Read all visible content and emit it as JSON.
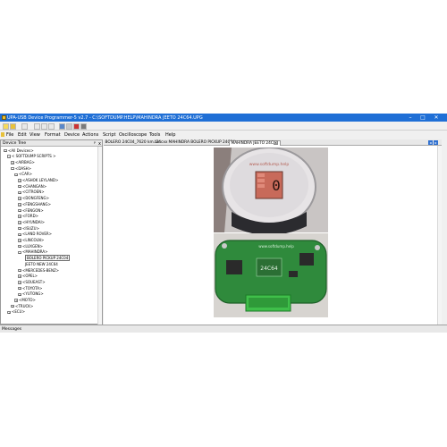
{
  "window": {
    "title": "UPA-USB Device Programmer-5 v2.7 - C:\\SOFTDUMP.HELP\\MAHINDRA JEETO 24C64.UPG",
    "minimize": "–",
    "maximize": "□",
    "close": "✕"
  },
  "menu": {
    "items": [
      "File",
      "Edit",
      "View",
      "Format",
      "Device",
      "Actions",
      "Script",
      "Oscilloscope",
      "Tools",
      "Help"
    ]
  },
  "device_tree": {
    "title": "Device Tree",
    "pin": "ᵖ",
    "close": "x",
    "rows": [
      {
        "label": "<All Devices>",
        "exp": "−"
      },
      {
        "label": "< SOFTDUMP SCRIPTS >",
        "exp": "−"
      },
      {
        "label": "<AIRBAG>",
        "exp": "+"
      },
      {
        "label": "<DASH>",
        "exp": "−"
      },
      {
        "label": "<CAR>",
        "exp": "−"
      },
      {
        "label": "<ASHOK LEYLAND>",
        "exp": "+"
      },
      {
        "label": "<CHANGAN>",
        "exp": "+"
      },
      {
        "label": "<CITROEN>",
        "exp": "+"
      },
      {
        "label": "<DONGFENG>",
        "exp": "+"
      },
      {
        "label": "<FENGSHANG>",
        "exp": "+"
      },
      {
        "label": "<FENGON>",
        "exp": "+"
      },
      {
        "label": "<FORD>",
        "exp": "+"
      },
      {
        "label": "<HYUNDAI>",
        "exp": "+"
      },
      {
        "label": "<ISUZU>",
        "exp": "+"
      },
      {
        "label": "<LAND ROVER>",
        "exp": "+"
      },
      {
        "label": "<LINCOLN>",
        "exp": "+"
      },
      {
        "label": "<LUXGEN>",
        "exp": "+"
      },
      {
        "label": "<MAHINDRA>",
        "exp": "−"
      },
      {
        "label": "BOLERO PICKUP 24C04",
        "exp": ""
      },
      {
        "label": "JEETO NEW 24C64",
        "exp": ""
      },
      {
        "label": "<MERCEDES-BENZ>",
        "exp": "+"
      },
      {
        "label": "<OPEL>",
        "exp": "+"
      },
      {
        "label": "<SOUEAST>",
        "exp": "+"
      },
      {
        "label": "<TOYOTA>",
        "exp": "+"
      },
      {
        "label": "<YUTONG>",
        "exp": "+"
      },
      {
        "label": "<MOTO>",
        "exp": "+"
      },
      {
        "label": "<TRUCK>",
        "exp": "+"
      },
      {
        "label": "<ECU>",
        "exp": "+"
      }
    ]
  },
  "tabs": {
    "items": [
      "BOLERO 24C04_7620 km.bin",
      "24cxx",
      "MAHINDRA BOLERO PICKUP 24C04",
      "MAHINDRA JEETO 24C64"
    ],
    "close": "x",
    "prev": "◂",
    "next": "▸"
  },
  "photo": {
    "display_digit": "0",
    "chip_label": "24C64",
    "board_text": "www.softdump.help",
    "glass_text": "www.softdump.help"
  },
  "messages": {
    "title": "Messages"
  },
  "colors": {
    "title_bar": "#1f6fd6",
    "pcb": "#2f8a3c",
    "connector": "#3fbf4a",
    "display_bg": "#c86a5a"
  }
}
